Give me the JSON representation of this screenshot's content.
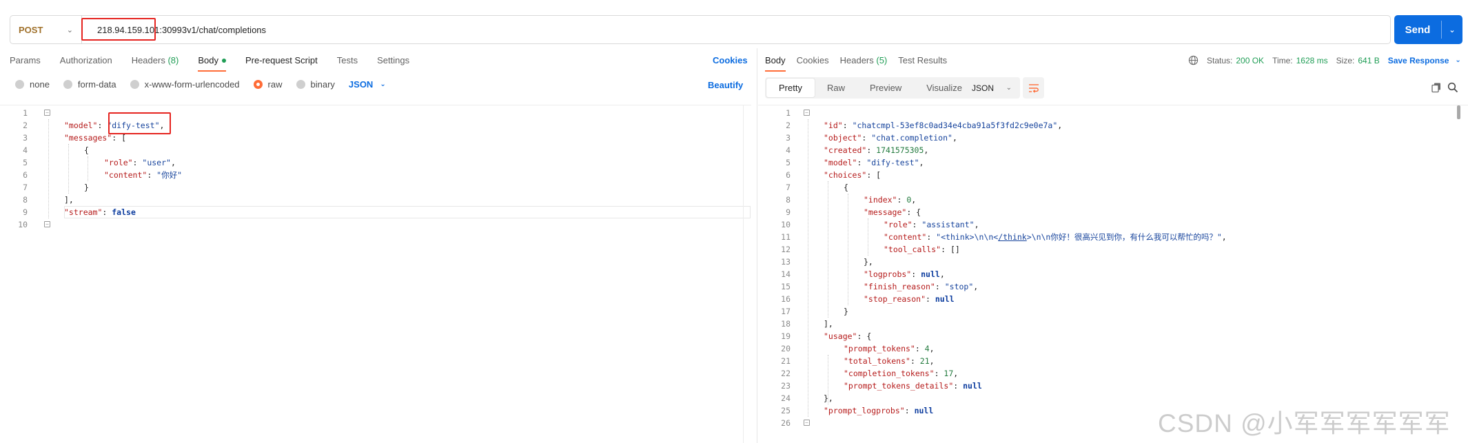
{
  "request": {
    "method": "POST",
    "url_host": "218.94.159.101:30993",
    "url_path": "v1/chat/completions",
    "send_label": "Send"
  },
  "request_tabs": [
    {
      "label": "Params"
    },
    {
      "label": "Authorization"
    },
    {
      "label": "Headers",
      "count": "(8)"
    },
    {
      "label": "Body"
    },
    {
      "label": "Pre-request Script"
    },
    {
      "label": "Tests"
    },
    {
      "label": "Settings"
    }
  ],
  "cookies_label": "Cookies",
  "beautify_label": "Beautify",
  "body_types": [
    "none",
    "form-data",
    "x-www-form-urlencoded",
    "raw",
    "binary"
  ],
  "body_format": "JSON",
  "response_tabs": [
    {
      "label": "Body"
    },
    {
      "label": "Cookies"
    },
    {
      "label": "Headers",
      "count": "(5)"
    },
    {
      "label": "Test Results"
    }
  ],
  "response_status": {
    "status_label": "Status:",
    "status_value": "200 OK",
    "time_label": "Time:",
    "time_value": "1628 ms",
    "size_label": "Size:",
    "size_value": "641 B",
    "save_label": "Save Response"
  },
  "response_views": [
    "Pretty",
    "Raw",
    "Preview",
    "Visualize"
  ],
  "response_format": "JSON",
  "request_body_lines": [
    "1",
    "2",
    "3",
    "4",
    "5",
    "6",
    "7",
    "8",
    "9",
    "10"
  ],
  "request_body_text": {
    "model_key": "\"model\"",
    "model_val": "\"dify-test\"",
    "messages_key": "\"messages\"",
    "role_key": "\"role\"",
    "role_val": "\"user\"",
    "content_key": "\"content\"",
    "content_val": "\"你好\"",
    "stream_key": "\"stream\"",
    "stream_val": "false"
  },
  "response_body_lines": [
    "1",
    "2",
    "3",
    "4",
    "5",
    "6",
    "7",
    "8",
    "9",
    "10",
    "11",
    "12",
    "13",
    "14",
    "15",
    "16",
    "17",
    "18",
    "19",
    "20",
    "21",
    "22",
    "23",
    "24",
    "25",
    "26"
  ],
  "response_body_text": {
    "id_key": "\"id\"",
    "id_val": "\"chatcmpl-53ef8c0ad34e4cba91a5f3fd2c9e0e7a\"",
    "object_key": "\"object\"",
    "object_val": "\"chat.completion\"",
    "created_key": "\"created\"",
    "created_val": "1741575305",
    "model_key": "\"model\"",
    "model_val": "\"dify-test\"",
    "choices_key": "\"choices\"",
    "index_key": "\"index\"",
    "index_val": "0",
    "message_key": "\"message\"",
    "role_key": "\"role\"",
    "role_val": "\"assistant\"",
    "content_key": "\"content\"",
    "content_val_a": "\"<think>\\n\\n<",
    "content_val_b": "/think",
    "content_val_c": ">\\n\\n你好！很高兴见到你，有什么我可以帮忙的吗？\"",
    "tool_calls_key": "\"tool_calls\"",
    "tool_calls_val": "[]",
    "logprobs_key": "\"logprobs\"",
    "logprobs_val": "null",
    "finish_reason_key": "\"finish_reason\"",
    "finish_reason_val": "\"stop\"",
    "stop_reason_key": "\"stop_reason\"",
    "stop_reason_val": "null",
    "usage_key": "\"usage\"",
    "prompt_tokens_key": "\"prompt_tokens\"",
    "prompt_tokens_val": "4",
    "total_tokens_key": "\"total_tokens\"",
    "total_tokens_val": "21",
    "completion_tokens_key": "\"completion_tokens\"",
    "completion_tokens_val": "17",
    "prompt_tokens_details_key": "\"prompt_tokens_details\"",
    "prompt_tokens_details_val": "null",
    "prompt_logprobs_key": "\"prompt_logprobs\"",
    "prompt_logprobs_val": "null"
  },
  "watermark": "CSDN @小军军军军军军",
  "colors": {
    "accent_orange": "#ff6c37",
    "send_blue": "#0c6ce0",
    "status_green": "#1f9d55",
    "highlight_red": "#e5231f"
  }
}
